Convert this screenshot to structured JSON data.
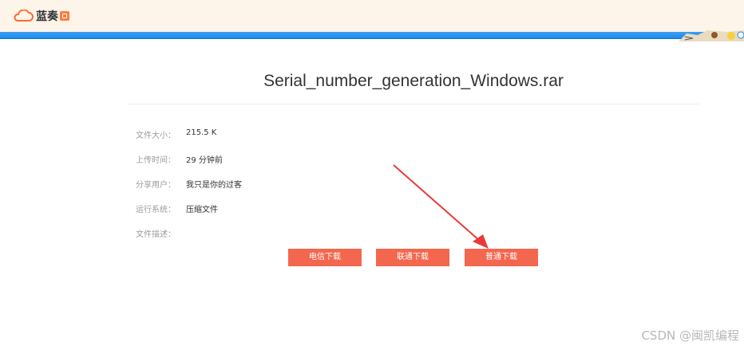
{
  "header": {
    "logo_text": "蓝奏",
    "logo_icon": "cloud-icon"
  },
  "file": {
    "name": "Serial_number_generation_Windows.rar",
    "fields": [
      {
        "label": "文件大小：",
        "value": "215.5 K"
      },
      {
        "label": "上传时间：",
        "value": "29 分钟前"
      },
      {
        "label": "分享用户：",
        "value": "我只是你的过客"
      },
      {
        "label": "运行系统：",
        "value": "压缩文件"
      },
      {
        "label": "文件描述：",
        "value": ""
      }
    ]
  },
  "buttons": {
    "telecom": "电信下载",
    "unicom": "联通下载",
    "normal": "普通下载"
  },
  "colors": {
    "header_bg": "#fdf4ea",
    "blue_bar": "#1f88e6",
    "button": "#f3674e",
    "arrow": "#e83a3a"
  },
  "watermark": "CSDN @闽凯编程"
}
